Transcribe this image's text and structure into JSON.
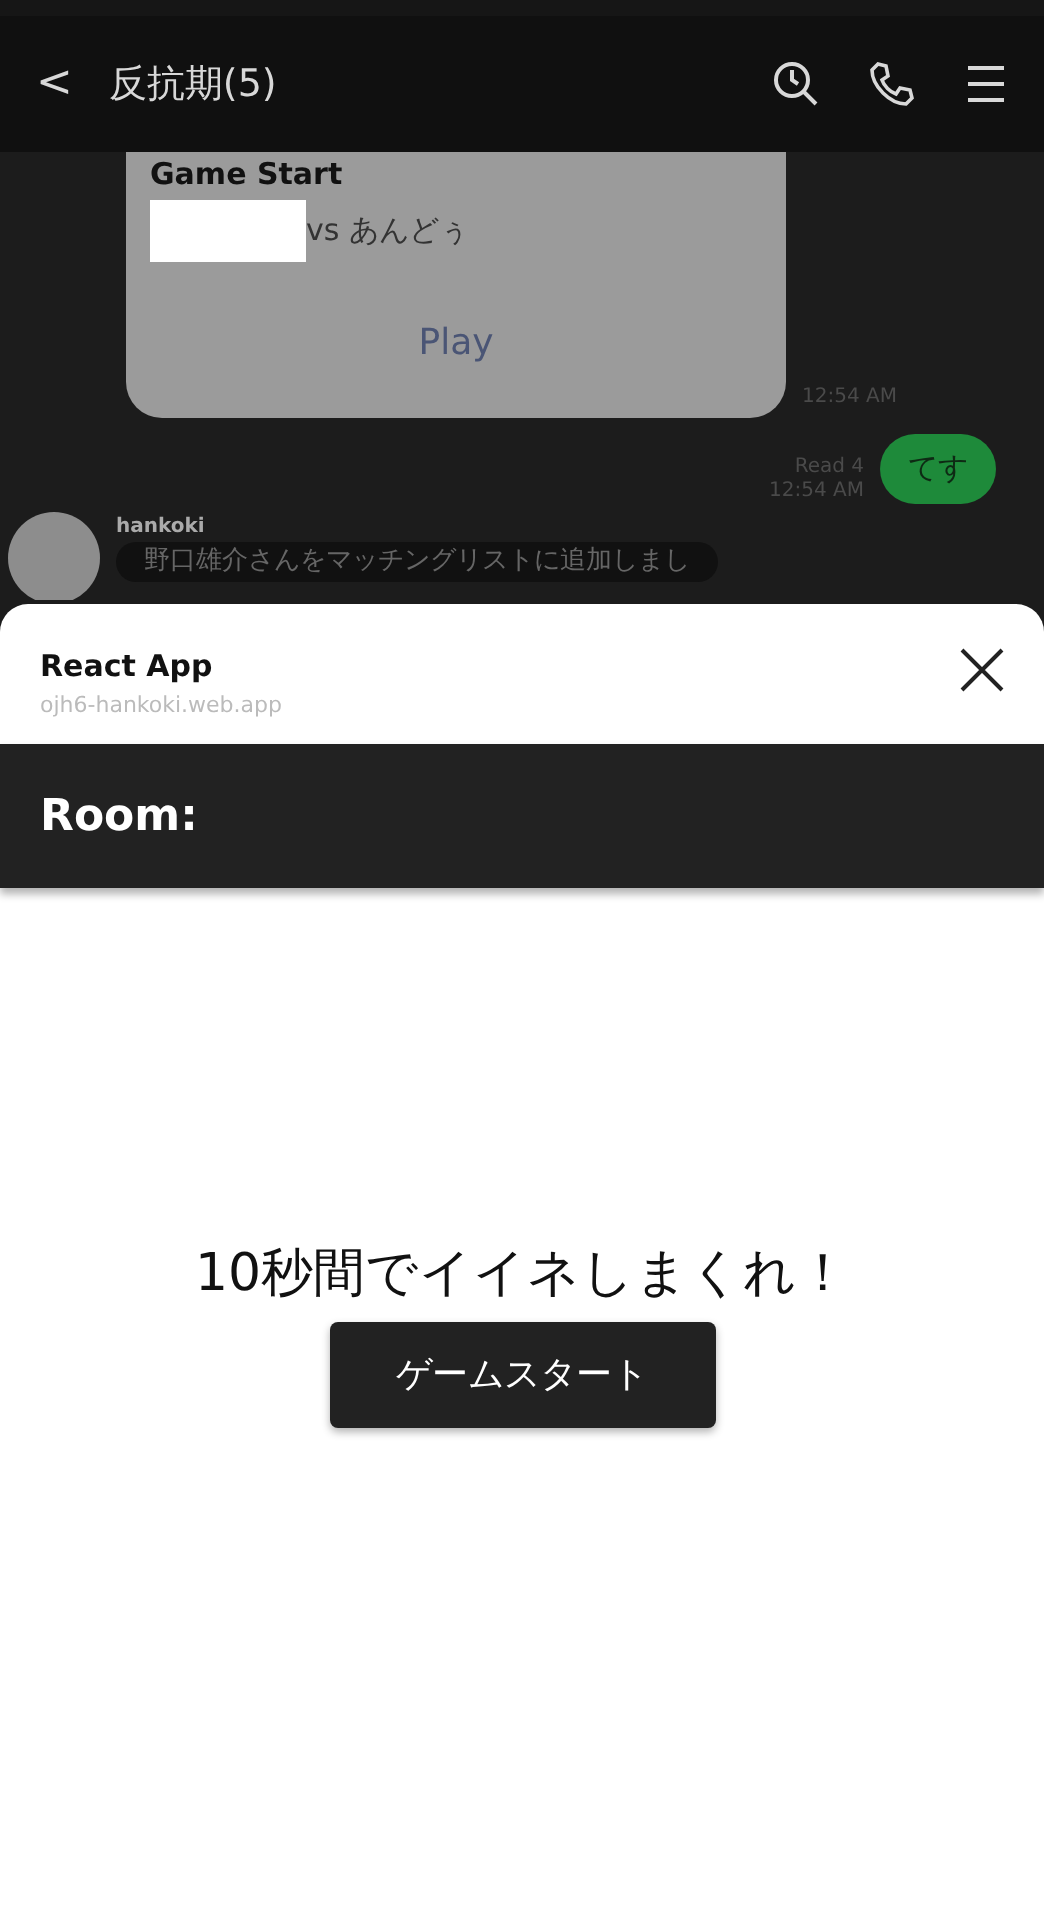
{
  "chat_header": {
    "back_icon": "<",
    "title": "反抗期(5)"
  },
  "messages": [
    {
      "kind": "card",
      "title": "Game Start",
      "vs_text": "vs あんどぅ",
      "action": "Play",
      "time": "12:54 AM"
    },
    {
      "kind": "sent",
      "text": "てす",
      "read": "Read 4",
      "time": "12:54 AM"
    },
    {
      "kind": "received",
      "sender": "hankoki",
      "text": "野口雄介さんをマッチングリストに追加しまし"
    }
  ],
  "sheet": {
    "title": "React App",
    "url": "ojh6-hankoki.web.app"
  },
  "app": {
    "room_label": "Room:",
    "headline": "10秒間でイイネしまくれ！",
    "start_button": "ゲームスタート"
  }
}
